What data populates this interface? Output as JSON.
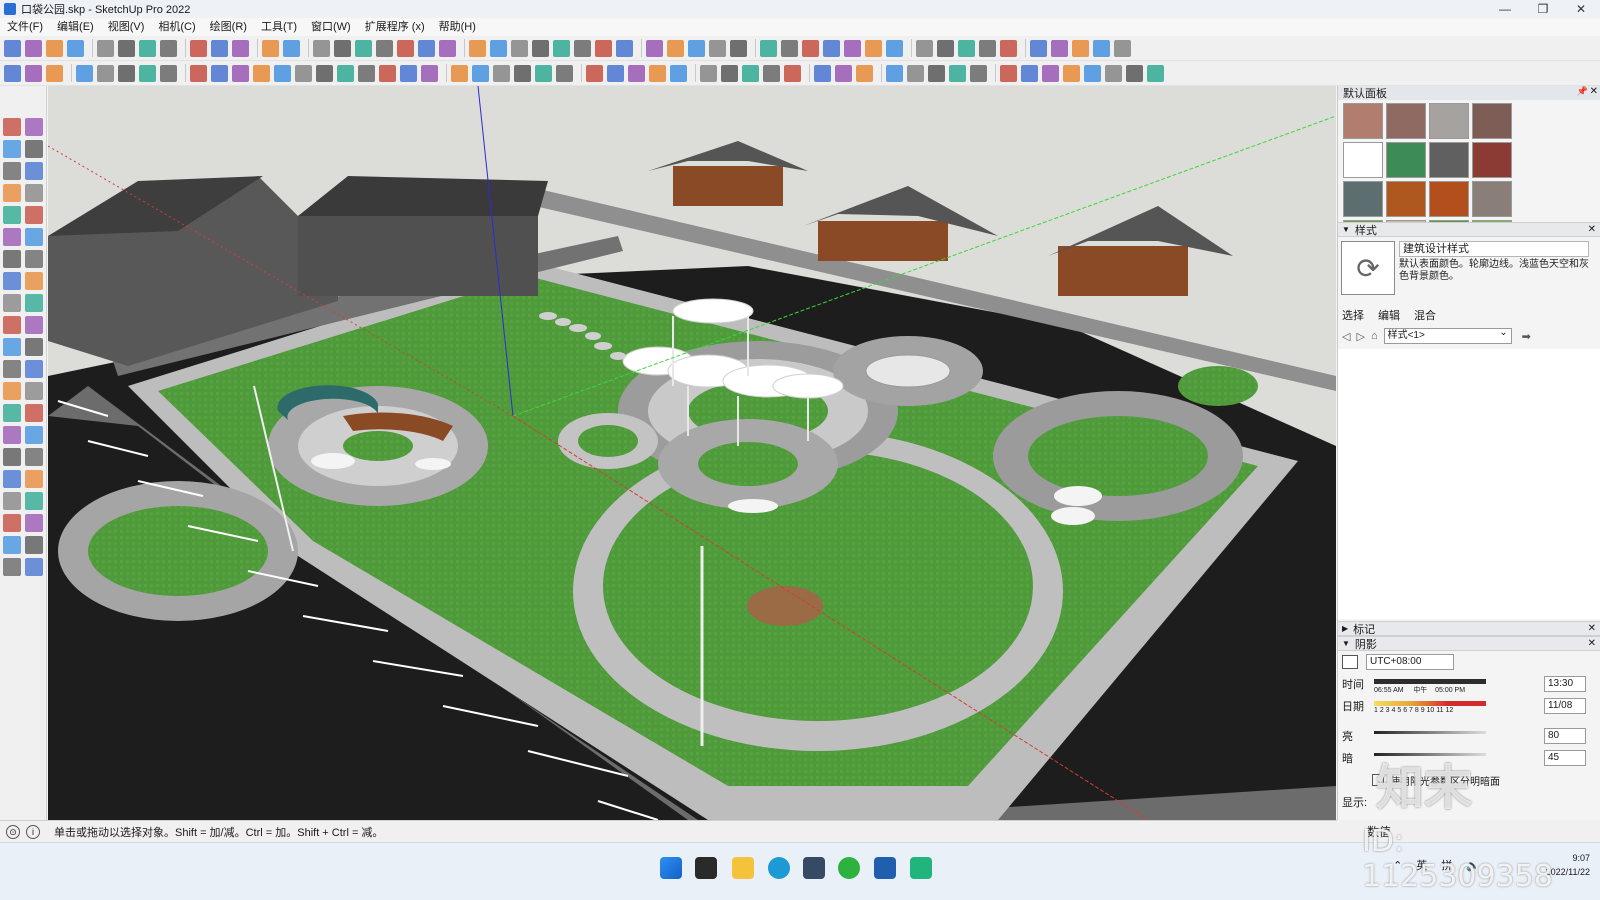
{
  "window": {
    "title": "口袋公园.skp - SketchUp Pro 2022",
    "controls": [
      "—",
      "❐",
      "✕"
    ]
  },
  "menu": [
    "文件(F)",
    "编辑(E)",
    "视图(V)",
    "相机(C)",
    "绘图(R)",
    "工具(T)",
    "窗口(W)",
    "扩展程序 (x)",
    "帮助(H)"
  ],
  "tray": {
    "title": "默认面板",
    "materials_swatch_colors": [
      "#b07d6e",
      "#8e6a63",
      "#a5a2a0",
      "#7d5d55",
      "#ffffff",
      "#3e8c55",
      "#606060",
      "#8b3b34",
      "#5d6e70",
      "#b0561f",
      "#b24f1c",
      "#8a7f78",
      "#6aa24b",
      "#d6bb8a",
      "#5d9b3a",
      "#78b44e"
    ],
    "styles": {
      "header": "样式",
      "name": "建筑设计样式",
      "description": "默认表面颜色。轮廓边线。浅蓝色天空和灰色背景颜色。",
      "tabs": [
        "选择",
        "编辑",
        "混合"
      ],
      "selected": "样式<1>"
    },
    "tags_header": "标记",
    "shadows": {
      "header": "阴影",
      "timezone": "UTC+08:00",
      "time_label": "时间",
      "time_start": "06:55 AM",
      "time_mid": "中午",
      "time_end": "05:00 PM",
      "time_value": "13:30",
      "date_label": "日期",
      "months": "1 2 3 4 5 6 7 8 9 10 11 12",
      "date_value": "11/08",
      "light_label": "亮",
      "light_value": "80",
      "dark_label": "暗",
      "dark_value": "45",
      "use_sun_label": "使用阳光参数区分明暗面",
      "display_label": "显示:"
    }
  },
  "status": {
    "message": "单击或拖动以选择对象。Shift = 加/减。Ctrl = 加。Shift + Ctrl = 减。",
    "measurements_label": "数值"
  },
  "taskbar": {
    "ime": "英",
    "ime2": "拼",
    "time": "9:07",
    "date": "2022/11/22"
  },
  "watermark": {
    "id_text": "ID: 1125309358",
    "logo": "知末"
  }
}
